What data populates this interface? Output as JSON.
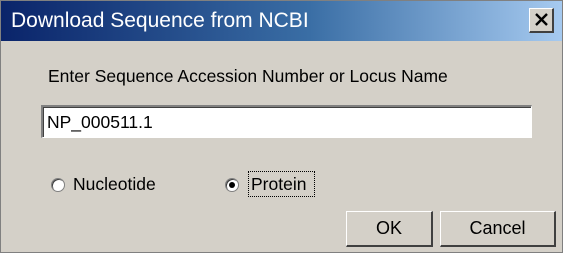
{
  "window": {
    "title": "Download Sequence from NCBI",
    "close_icon": "close-icon"
  },
  "form": {
    "prompt": "Enter Sequence Accession Number or Locus Name",
    "accession_value": "NP_000511.1",
    "radio_options": [
      {
        "label": "Nucleotide",
        "selected": false
      },
      {
        "label": "Protein",
        "selected": true
      }
    ]
  },
  "buttons": {
    "ok_label": "OK",
    "cancel_label": "Cancel"
  },
  "colors": {
    "title_bar_start": "#0a246a",
    "title_bar_end": "#a6caf0",
    "dialog_face": "#d4d0c8"
  }
}
